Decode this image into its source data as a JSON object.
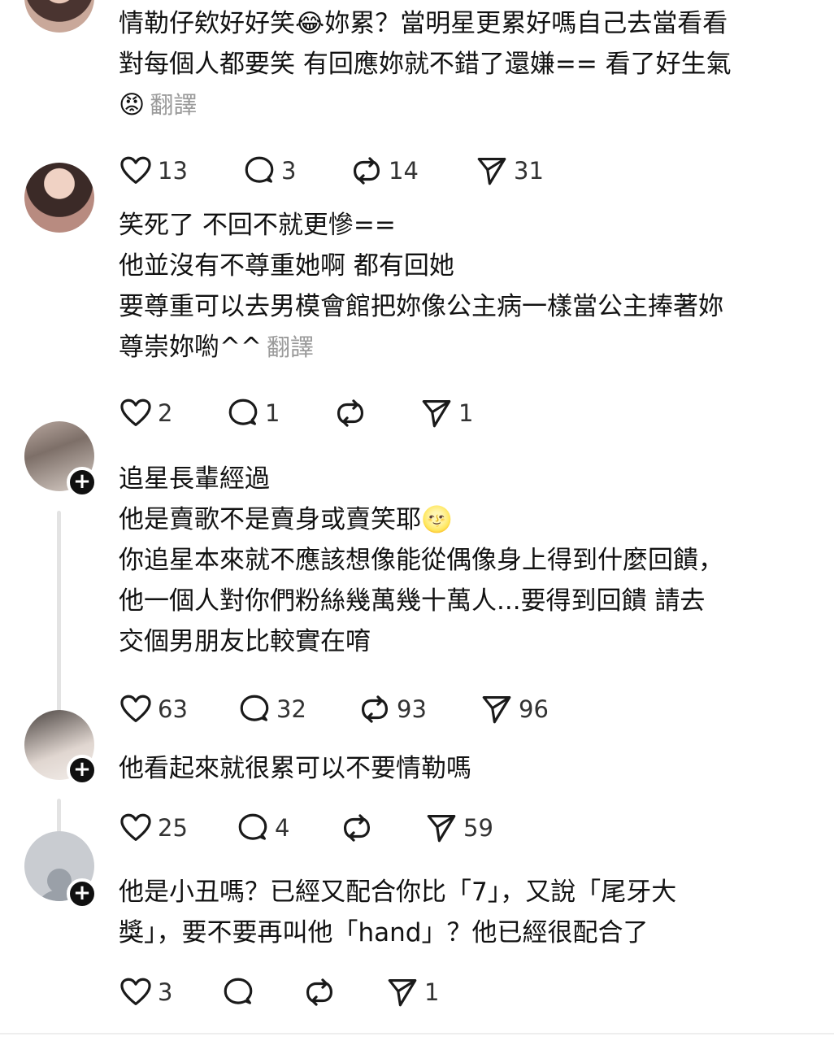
{
  "comments": [
    {
      "text": "情勒仔欸好好笑😂妳累？當明星更累好嗎自己去當看看\n對每個人都要笑 有回應妳就不錯了還嫌== 看了好生氣\n😡",
      "translate": "翻譯",
      "likes": "13",
      "replies": "3",
      "reposts": "14",
      "shares": "31"
    },
    {
      "text": "笑死了 不回不就更慘==\n他並沒有不尊重她啊 都有回她\n要尊重可以去男模會館把妳像公主病一樣當公主捧著妳\n尊崇妳喲^^",
      "translate": "翻譯",
      "likes": "2",
      "replies": "1",
      "reposts": "",
      "shares": "1"
    },
    {
      "text": "追星長輩經過\n他是賣歌不是賣身或賣笑耶🌝\n你追星本來就不應該想像能從偶像身上得到什麼回饋，\n他一個人對你們粉絲幾萬幾十萬人...要得到回饋 請去\n交個男朋友比較實在唷",
      "likes": "63",
      "replies": "32",
      "reposts": "93",
      "shares": "96"
    },
    {
      "text": "他看起來就很累可以不要情勒嗎",
      "likes": "25",
      "replies": "4",
      "reposts": "",
      "shares": "59"
    },
    {
      "text": "他是小丑嗎？已經又配合你比「7」，又說「尾牙大\n獎」，要不要再叫他「hand」？他已經很配合了",
      "likes": "3",
      "replies": "",
      "reposts": "",
      "shares": "1"
    }
  ],
  "icons": {
    "like": "heart-icon",
    "reply": "comment-bubble-icon",
    "repost": "repost-arrows-icon",
    "share": "send-paper-plane-icon",
    "follow": "plus-icon"
  }
}
